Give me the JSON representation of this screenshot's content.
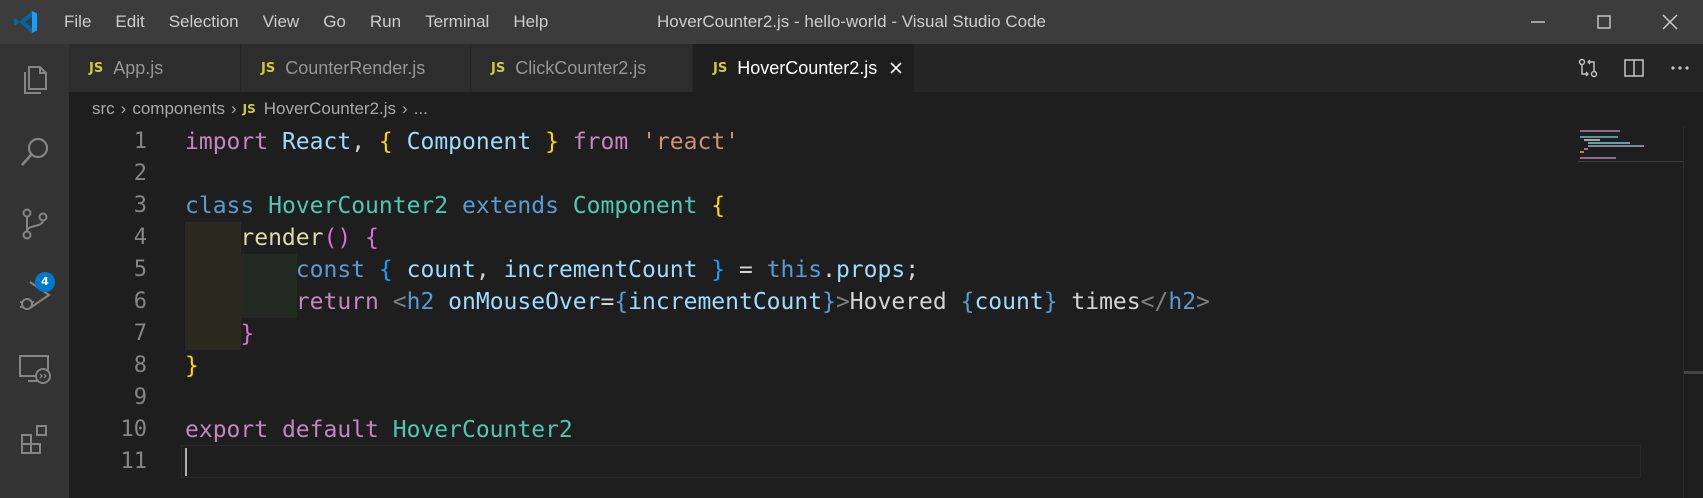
{
  "window": {
    "title": "HoverCounter2.js - hello-world - Visual Studio Code",
    "menu": [
      "File",
      "Edit",
      "Selection",
      "View",
      "Go",
      "Run",
      "Terminal",
      "Help"
    ]
  },
  "activity_bar": {
    "items": [
      {
        "icon": "explorer-icon"
      },
      {
        "icon": "search-icon"
      },
      {
        "icon": "source-control-icon",
        "badge": "4"
      },
      {
        "icon": "run-debug-icon"
      },
      {
        "icon": "remote-explorer-icon"
      },
      {
        "icon": "extensions-icon"
      }
    ]
  },
  "tabs": [
    {
      "label": "App.js",
      "icon_text": "JS"
    },
    {
      "label": "CounterRender.js",
      "icon_text": "JS"
    },
    {
      "label": "ClickCounter2.js",
      "icon_text": "JS"
    },
    {
      "label": "HoverCounter2.js",
      "icon_text": "JS",
      "active": true
    }
  ],
  "breadcrumb": {
    "items": [
      "src",
      "components",
      "HoverCounter2.js",
      "..."
    ],
    "file_icon_text": "JS"
  },
  "editor": {
    "line_numbers": [
      "1",
      "2",
      "3",
      "4",
      "5",
      "6",
      "7",
      "8",
      "9",
      "10",
      "11"
    ],
    "lines": [
      [
        [
          "kw",
          "import"
        ],
        [
          "pl",
          " "
        ],
        [
          "id",
          "React"
        ],
        [
          "pl",
          ", "
        ],
        [
          "br1",
          "{"
        ],
        [
          "pl",
          " "
        ],
        [
          "id",
          "Component"
        ],
        [
          "pl",
          " "
        ],
        [
          "br1",
          "}"
        ],
        [
          "pl",
          " "
        ],
        [
          "kw",
          "from"
        ],
        [
          "pl",
          " "
        ],
        [
          "str",
          "'react'"
        ]
      ],
      [],
      [
        [
          "st",
          "class"
        ],
        [
          "pl",
          " "
        ],
        [
          "ty",
          "HoverCounter2"
        ],
        [
          "pl",
          " "
        ],
        [
          "st",
          "extends"
        ],
        [
          "pl",
          " "
        ],
        [
          "ty",
          "Component"
        ],
        [
          "pl",
          " "
        ],
        [
          "br1",
          "{"
        ]
      ],
      [
        [
          "pl",
          "    "
        ],
        [
          "fn",
          "render"
        ],
        [
          "br2",
          "()"
        ],
        [
          "pl",
          " "
        ],
        [
          "br2",
          "{"
        ]
      ],
      [
        [
          "pl",
          "        "
        ],
        [
          "st",
          "const"
        ],
        [
          "pl",
          " "
        ],
        [
          "br3",
          "{"
        ],
        [
          "pl",
          " "
        ],
        [
          "id",
          "count"
        ],
        [
          "pl",
          ", "
        ],
        [
          "id",
          "incrementCount"
        ],
        [
          "pl",
          " "
        ],
        [
          "br3",
          "}"
        ],
        [
          "pl",
          " = "
        ],
        [
          "st",
          "this"
        ],
        [
          "pl",
          "."
        ],
        [
          "id",
          "props"
        ],
        [
          "pl",
          ";"
        ]
      ],
      [
        [
          "pl",
          "        "
        ],
        [
          "kw",
          "return"
        ],
        [
          "pl",
          " "
        ],
        [
          "tg",
          "<"
        ],
        [
          "st",
          "h2"
        ],
        [
          "pl",
          " "
        ],
        [
          "id",
          "onMouseOver"
        ],
        [
          "pl",
          "="
        ],
        [
          "st",
          "{"
        ],
        [
          "id",
          "incrementCount"
        ],
        [
          "st",
          "}"
        ],
        [
          "tg",
          ">"
        ],
        [
          "pl",
          "Hovered "
        ],
        [
          "st",
          "{"
        ],
        [
          "id",
          "count"
        ],
        [
          "st",
          "}"
        ],
        [
          "pl",
          " times"
        ],
        [
          "tg",
          "</"
        ],
        [
          "st",
          "h2"
        ],
        [
          "tg",
          ">"
        ]
      ],
      [
        [
          "pl",
          "    "
        ],
        [
          "br2",
          "}"
        ]
      ],
      [
        [
          "br1",
          "}"
        ]
      ],
      [],
      [
        [
          "kw",
          "export"
        ],
        [
          "pl",
          " "
        ],
        [
          "kw",
          "default"
        ],
        [
          "pl",
          " "
        ],
        [
          "ty",
          "HoverCounter2"
        ]
      ],
      []
    ]
  },
  "colors": {
    "titlebar": "#3c3c3c",
    "activitybar": "#333333",
    "editor_bg": "#1e1e1e",
    "accent": "#007acc",
    "js_icon": "#cbcb41"
  }
}
